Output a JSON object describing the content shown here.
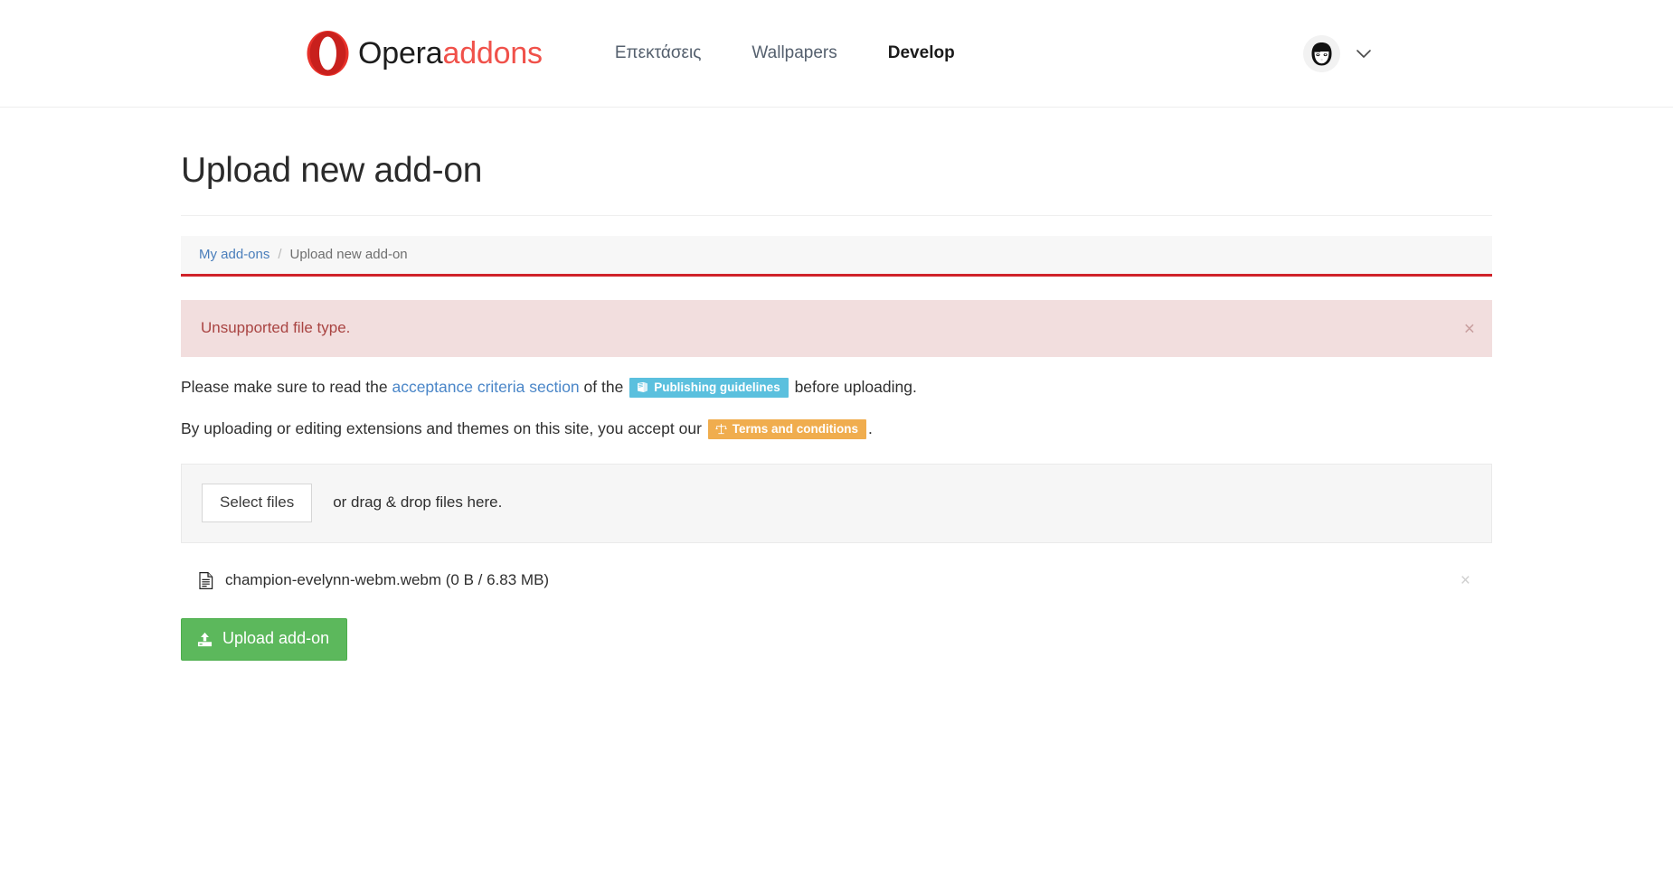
{
  "header": {
    "brand": {
      "logo_icon": "opera-o-icon",
      "name_primary": "Opera",
      "name_secondary": "addons"
    },
    "nav": [
      {
        "label": "Επεκτάσεις",
        "active": false,
        "name": "nav-extensions"
      },
      {
        "label": "Wallpapers",
        "active": false,
        "name": "nav-wallpapers"
      },
      {
        "label": "Develop",
        "active": true,
        "name": "nav-develop"
      }
    ],
    "account": {
      "avatar_icon": "user-avatar-icon",
      "caret_icon": "chevron-down-icon"
    }
  },
  "page": {
    "title": "Upload new add-on"
  },
  "breadcrumb": {
    "items": [
      {
        "label": "My add-ons",
        "is_link": true
      },
      {
        "label": "Upload new add-on",
        "is_link": false
      }
    ],
    "separator": "/",
    "accent_color": "#d0222a"
  },
  "alert": {
    "message": "Unsupported file type.",
    "close_label": "×",
    "background": "#f2dede",
    "text_color": "#a94442"
  },
  "info": {
    "line1": {
      "before": "Please make sure to read the ",
      "link": "acceptance criteria section",
      "middle": " of the ",
      "badge": {
        "label": "Publishing guidelines",
        "icon": "book-icon",
        "color": "#5bc0de"
      },
      "after": " before uploading."
    },
    "line2": {
      "before": "By uploading or editing extensions and themes on this site, you accept our ",
      "badge": {
        "label": "Terms and conditions",
        "icon": "balance-scale-icon",
        "color": "#f0ad4e"
      },
      "after": "."
    }
  },
  "dropzone": {
    "select_button": "Select files",
    "hint": "or drag & drop files here."
  },
  "files": [
    {
      "icon": "file-document-icon",
      "name": "champion-evelynn-webm.webm (0 B / 6.83 MB)",
      "remove_label": "×"
    }
  ],
  "upload": {
    "label": "Upload add-on",
    "icon": "upload-icon",
    "color": "#5cb85c"
  }
}
